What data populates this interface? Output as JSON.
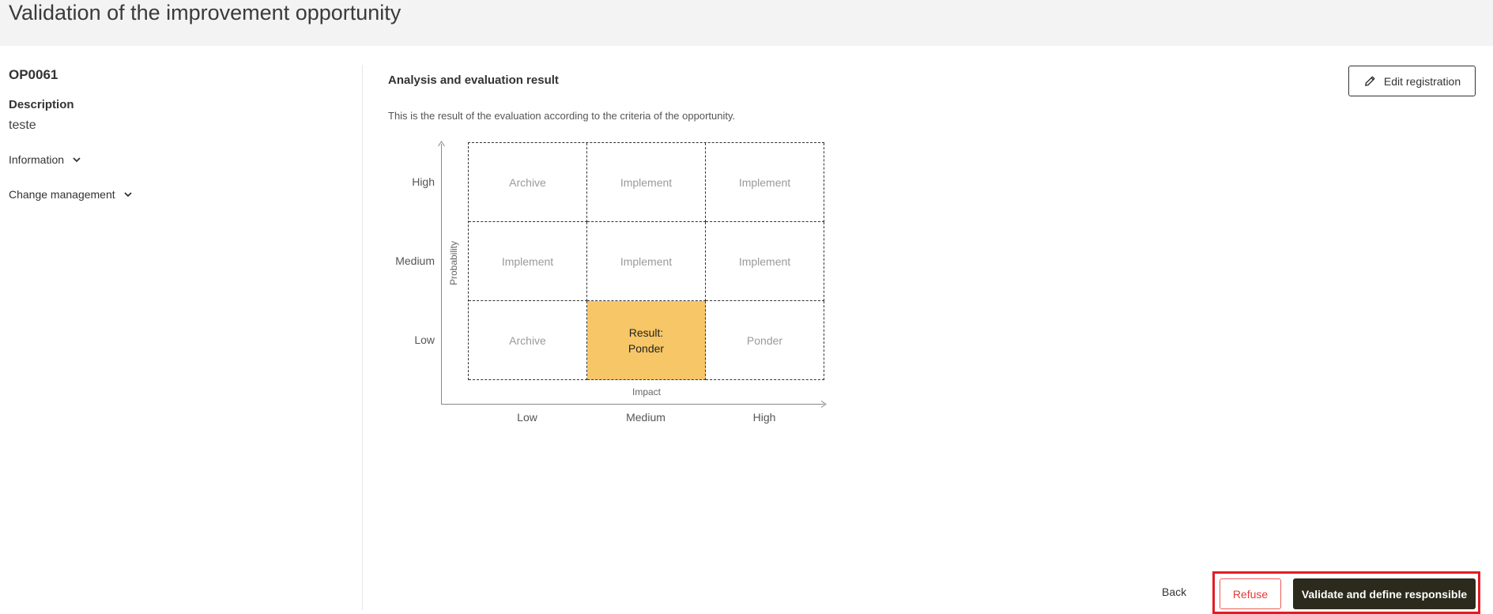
{
  "header": {
    "title": "Validation of the improvement opportunity"
  },
  "left": {
    "code": "OP0061",
    "description_label": "Description",
    "description_value": "teste",
    "sections": [
      {
        "label": "Information",
        "icon": "chevron-down-icon"
      },
      {
        "label": "Change management",
        "icon": "chevron-down-icon"
      }
    ]
  },
  "main": {
    "title": "Analysis and evaluation result",
    "description": "This is the result of the evaluation according to the criteria of the opportunity.",
    "edit_button": {
      "label": "Edit registration",
      "icon": "pencil-icon"
    }
  },
  "matrix": {
    "y_axis_label": "Probability",
    "x_axis_label": "Impact",
    "row_labels": [
      "High",
      "Medium",
      "Low"
    ],
    "col_labels": [
      "Low",
      "Medium",
      "High"
    ],
    "cells": [
      [
        "Archive",
        "Implement",
        "Implement"
      ],
      [
        "Implement",
        "Implement",
        "Implement"
      ],
      [
        "Archive",
        "Result:\nPonder",
        "Ponder"
      ]
    ],
    "result_highlight_color": "#f7c666"
  },
  "footer": {
    "back_label": "Back",
    "refuse_label": "Refuse",
    "validate_label": "Validate and define responsible",
    "highlight_color": "#e31c23"
  }
}
